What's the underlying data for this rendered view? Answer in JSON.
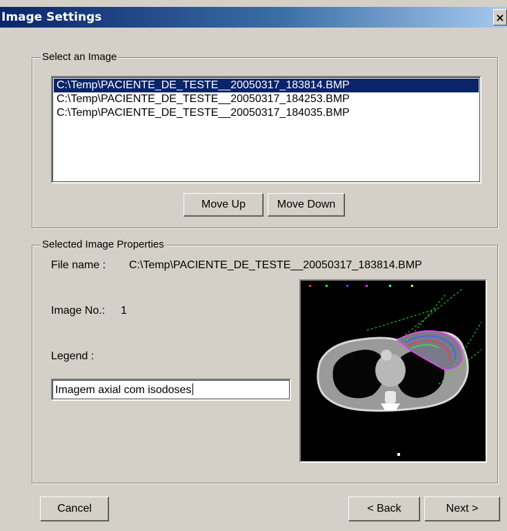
{
  "window": {
    "title": "Image Settings",
    "close_glyph": "×"
  },
  "select_group": {
    "label": "Select an Image",
    "items": [
      {
        "label": "C:\\Temp\\PACIENTE_DE_TESTE__20050317_183814.BMP",
        "selected": true
      },
      {
        "label": "C:\\Temp\\PACIENTE_DE_TESTE__20050317_184253.BMP",
        "selected": false
      },
      {
        "label": "C:\\Temp\\PACIENTE_DE_TESTE__20050317_184035.BMP",
        "selected": false
      }
    ],
    "move_up_label": "Move Up",
    "move_down_label": "Move Down"
  },
  "properties_group": {
    "label": "Selected Image Properties",
    "file_name_label": "File name :",
    "file_name_value": "C:\\Temp\\PACIENTE_DE_TESTE__20050317_183814.BMP",
    "image_no_label": "Image No.:",
    "image_no_value": "1",
    "legend_label": "Legend :",
    "legend_value": "Imagem axial com isodoses"
  },
  "footer": {
    "cancel_label": "Cancel",
    "back_label": "< Back",
    "next_label": "Next >"
  },
  "colors": {
    "dialog_bg": "#d4d0c8",
    "selection": "#0a246a",
    "titlebar_start": "#0a246a"
  },
  "icons": {
    "close": "close-icon",
    "preview": "ct-scan-image"
  }
}
